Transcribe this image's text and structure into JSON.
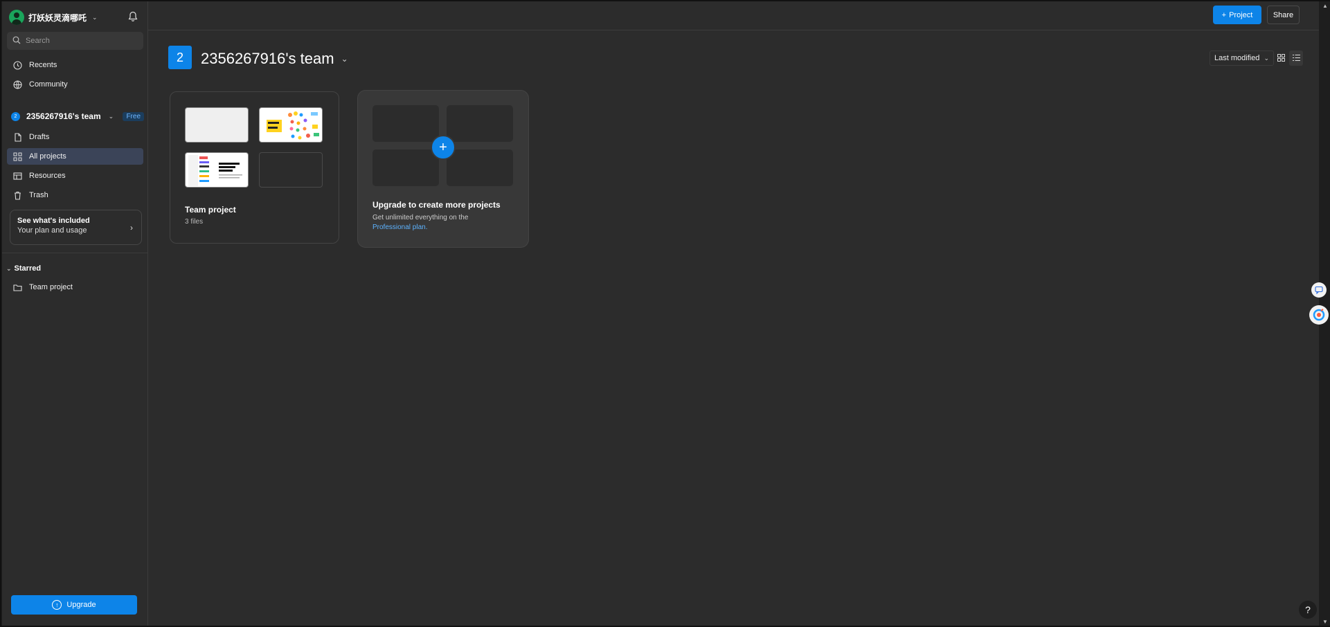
{
  "user": {
    "name": "打妖妖灵滴哪吒"
  },
  "search": {
    "placeholder": "Search"
  },
  "nav": {
    "recents": "Recents",
    "community": "Community",
    "drafts": "Drafts",
    "all_projects": "All projects",
    "resources": "Resources",
    "trash": "Trash"
  },
  "team": {
    "initial": "2",
    "name": "2356267916's team",
    "plan_badge": "Free"
  },
  "plan_card": {
    "title": "See what's included",
    "subtitle": "Your plan and usage"
  },
  "starred": {
    "heading": "Starred",
    "items": [
      {
        "label": "Team project"
      }
    ]
  },
  "upgrade_button": {
    "label": "Upgrade"
  },
  "topbar": {
    "project_button": "Project",
    "share_button": "Share"
  },
  "page": {
    "team_initial": "2",
    "title": "2356267916's team",
    "sort_label": "Last modified"
  },
  "project_card": {
    "title": "Team project",
    "file_count": "3 files"
  },
  "upgrade_card": {
    "title": "Upgrade to create more projects",
    "text": "Get unlimited everything on the",
    "link": "Professional plan."
  },
  "help": {
    "label": "?"
  },
  "colors": {
    "accent": "#0d84e8",
    "sidebar_bg": "#2c2c2c",
    "active_bg": "#3b4458",
    "free_badge": "#6fb6ff"
  }
}
